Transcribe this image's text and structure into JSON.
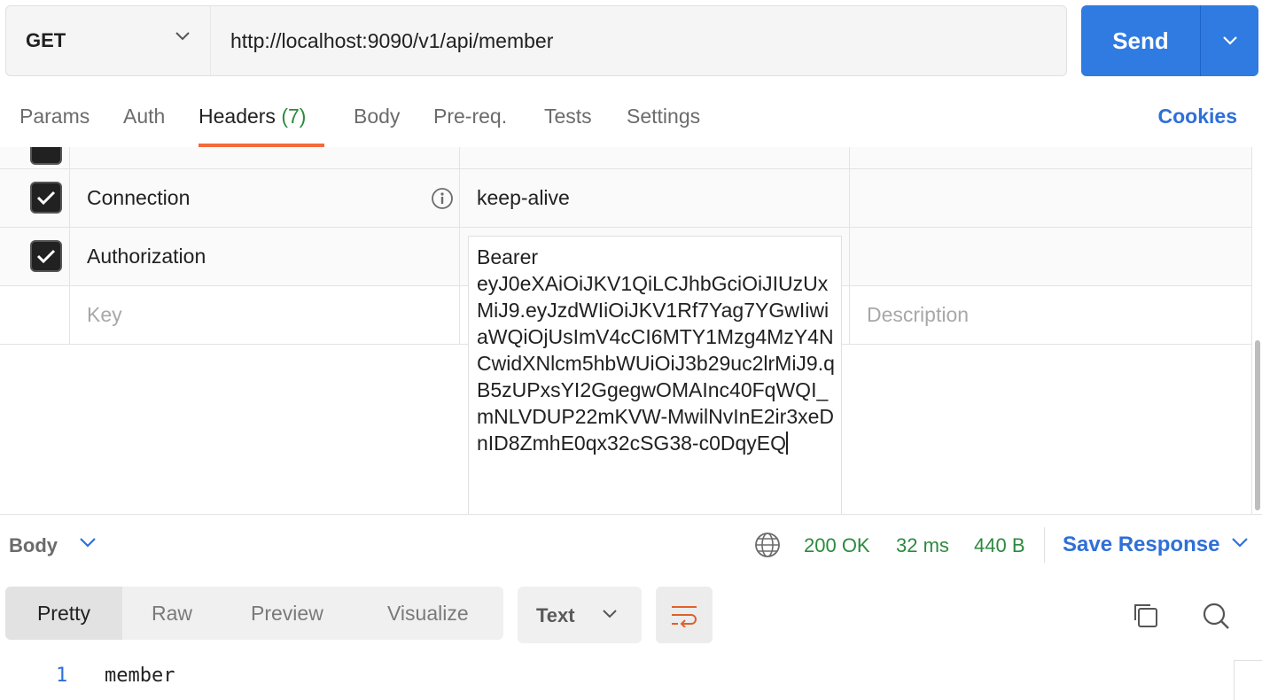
{
  "request": {
    "method": "GET",
    "url": "http://localhost:9090/v1/api/member",
    "send_label": "Send"
  },
  "tabs": [
    {
      "label": "Params"
    },
    {
      "label": "Auth"
    },
    {
      "label": "Headers",
      "count": "(7)"
    },
    {
      "label": "Body"
    },
    {
      "label": "Pre-req."
    },
    {
      "label": "Tests"
    },
    {
      "label": "Settings"
    }
  ],
  "active_tab": "Headers",
  "cookies_label": "Cookies",
  "headers": {
    "rows": [
      {
        "key": "Connection",
        "value": "keep-alive",
        "checked": true
      },
      {
        "key": "Authorization",
        "checked": true
      }
    ],
    "auth_value_prefix": "Bearer",
    "auth_value_token": "eyJ0eXAiOiJKV1QiLCJhbGciOiJIUzUxMiJ9.eyJzdWIiOiJKV1Rf7Yag7YGwIiwiaWQiOjUsImV4cCI6MTY1Mzg4MzY4NCwidXNlcm5hbWUiOiJ3b29uc2lrMiJ9.qB5zUPxsYI2GgegwOMAInc40FqWQI_mNLVDUP22mKVW-MwilNvInE2ir3xeDnID8ZmhE0qx32cSG38-c0DqyEQ",
    "key_placeholder": "Key",
    "desc_placeholder": "Description"
  },
  "response": {
    "body_label": "Body",
    "status": "200 OK",
    "time": "32 ms",
    "size": "440 B",
    "save_label": "Save Response",
    "views": [
      "Pretty",
      "Raw",
      "Preview",
      "Visualize"
    ],
    "active_view": "Pretty",
    "format": "Text",
    "lines": [
      {
        "num": "1",
        "text": "member"
      }
    ]
  },
  "colors": {
    "send": "#2f7be2",
    "active_tab_underline": "#f26b3a",
    "status_green": "#2b8a3e",
    "link_blue": "#2f6fd8"
  }
}
